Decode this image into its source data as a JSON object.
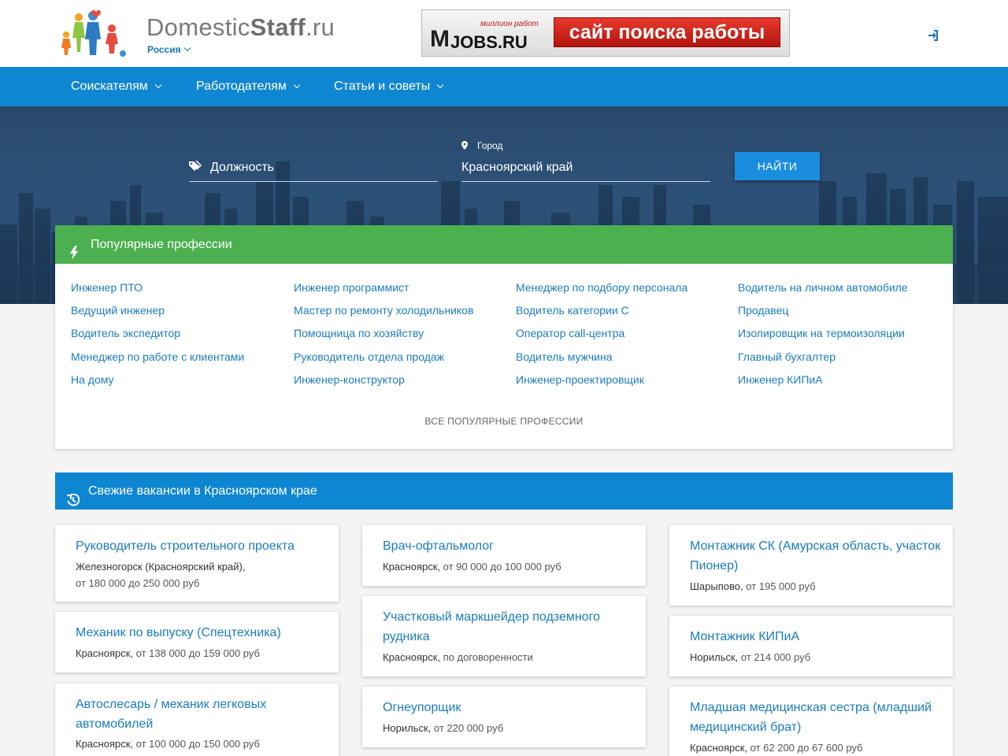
{
  "header": {
    "brand_light": "Domestic",
    "brand_bold": "Staff",
    "brand_tld": ".ru",
    "region": "Россия",
    "banner": {
      "tagline": "миллион работ",
      "logo_text": "JOBS.RU",
      "cta": "сайт поиска работы"
    },
    "login_icon": "sign-in-icon"
  },
  "nav": {
    "items": [
      {
        "label": "Соискателям"
      },
      {
        "label": "Работодателям"
      },
      {
        "label": "Статьи и советы"
      }
    ]
  },
  "search": {
    "position_value": "Должность",
    "city_label": "Город",
    "city_value": "Красноярский край",
    "button": "НАЙТИ"
  },
  "popular": {
    "title": "Популярные профессии",
    "columns": [
      [
        "Инженер ПТО",
        "Ведущий инженер",
        "Водитель экспедитор",
        "Менеджер по работе с клиентами",
        "На дому"
      ],
      [
        "Инженер программист",
        "Мастер по ремонту холодильников",
        "Помощница по хозяйству",
        "Руководитель отдела продаж",
        "Инженер-конструктор"
      ],
      [
        "Менеджер по подбору персонала",
        "Водитель категории С",
        "Оператор call-центра",
        "Водитель мужчина",
        "Инженер-проектировщик"
      ],
      [
        "Водитель на личном автомобиле",
        "Продавец",
        "Изолировщик на термоизоляции",
        "Главный бухгалтер",
        "Инженер КИПиА"
      ]
    ],
    "all_link": "ВСЕ ПОПУЛЯРНЫЕ ПРОФЕССИИ"
  },
  "fresh": {
    "title": "Свежие вакансии в Красноярском крае",
    "columns": [
      [
        {
          "title": "Руководитель строительного проекта",
          "city": "Железногорск (Красноярский край),",
          "salary": "от 180 000 до 250 000 руб"
        },
        {
          "title": "Механик по выпуску (Спецтехника)",
          "city": "Красноярск,",
          "salary": "от 138 000 до 159 000 руб"
        },
        {
          "title": "Автослесарь / механик легковых автомобилей",
          "city": "Красноярск,",
          "salary": "от 100 000 до 150 000 руб"
        }
      ],
      [
        {
          "title": "Врач-офтальмолог",
          "city": "Красноярск,",
          "salary": "от 90 000 до 100 000 руб"
        },
        {
          "title": "Участковый маркшейдер подземного рудника",
          "city": "Красноярск,",
          "salary": "по договоренности"
        },
        {
          "title": "Огнеупорщик",
          "city": "Норильск,",
          "salary": "от 220 000 руб"
        }
      ],
      [
        {
          "title": "Монтажник СК (Амурская область, участок Пионер)",
          "city": "Шарыпово,",
          "salary": "от 195 000 руб"
        },
        {
          "title": "Монтажник КИПиА",
          "city": "Норильск,",
          "salary": "от 214 000 руб"
        },
        {
          "title": "Младшая медицинская сестра (младший медицинский брат)",
          "city": "Красноярск,",
          "salary": "от 62 200 до 67 600 руб"
        }
      ]
    ]
  }
}
